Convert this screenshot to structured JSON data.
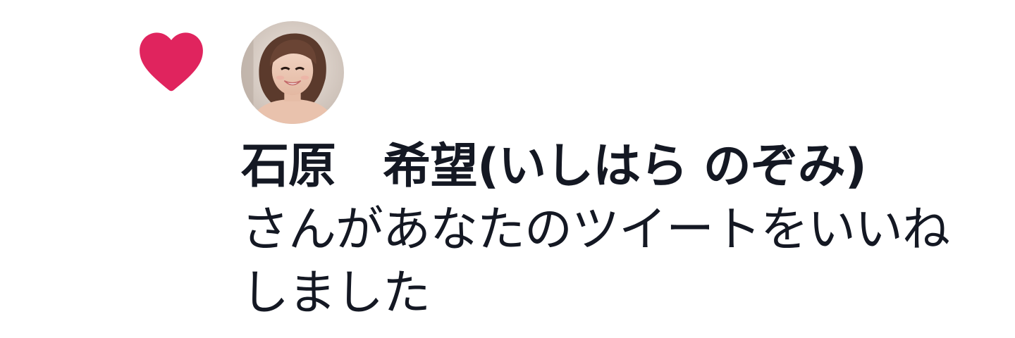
{
  "notification": {
    "icon": "heart-icon",
    "accent_color": "#e0245e",
    "user": {
      "display_name": "石原　希望(いしはら のぞみ)"
    },
    "action_text": "さんがあなたのツイートをいいねしました"
  }
}
